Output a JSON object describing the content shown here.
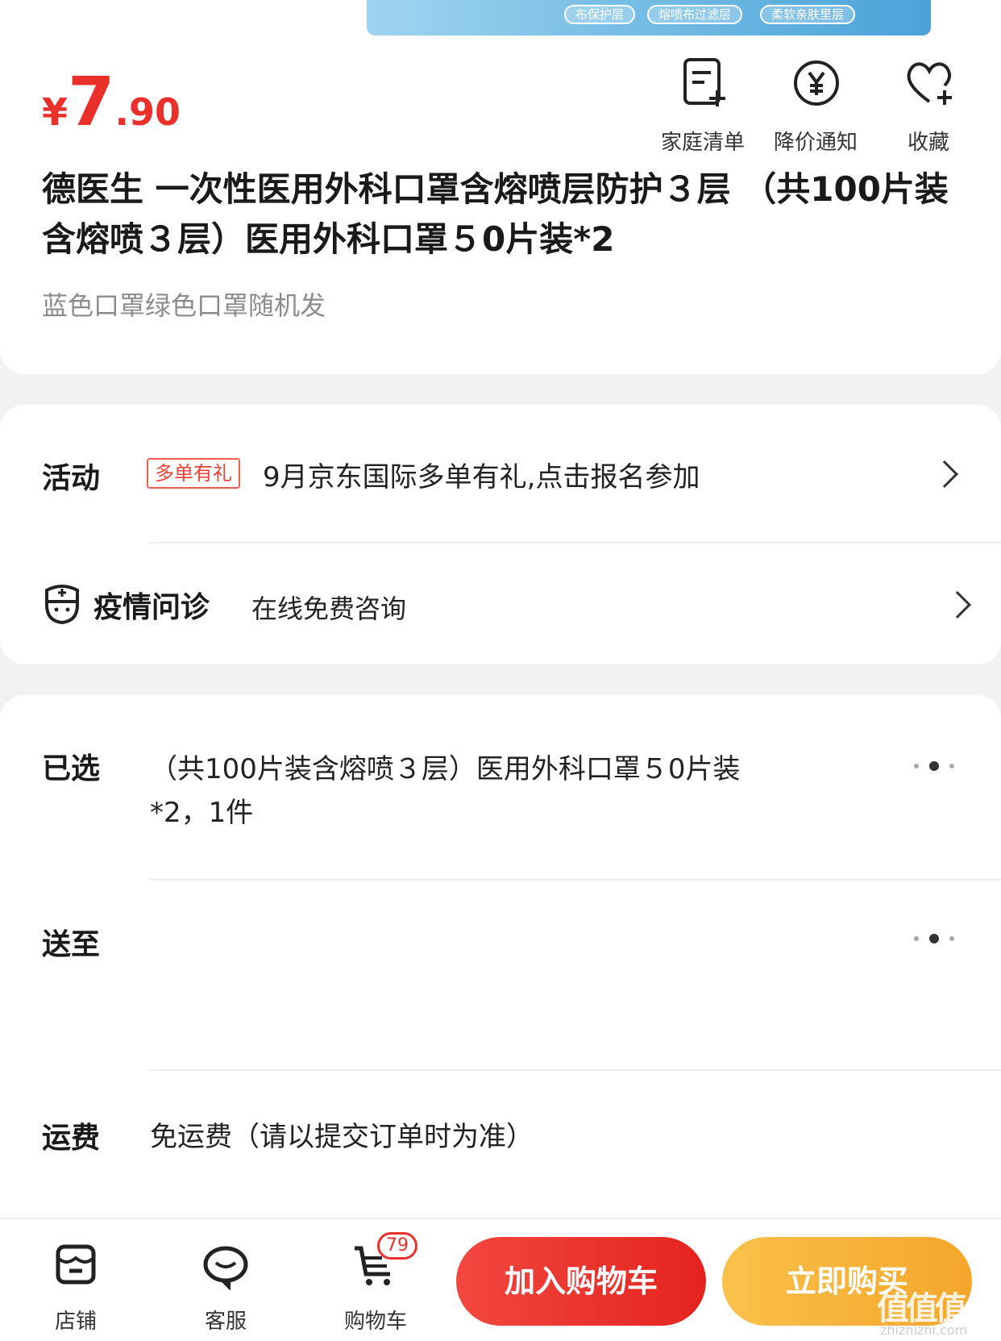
{
  "hero": {
    "tags": [
      "布保护层",
      "熔喷布过滤层",
      "柔软亲肤里层"
    ]
  },
  "price": {
    "currency": "¥",
    "integer": "7",
    "decimal": ".90"
  },
  "actions": [
    {
      "label": "家庭清单",
      "icon": "list-add-icon"
    },
    {
      "label": "降价通知",
      "icon": "price-alert-icon"
    },
    {
      "label": "收藏",
      "icon": "heart-add-icon"
    }
  ],
  "product": {
    "title": "德医生 一次性医用外科口罩含熔喷层防护３层 （共100片装含熔喷３层）医用外科口罩５0片装*2",
    "subtitle": "蓝色口罩绿色口罩随机发"
  },
  "activity": {
    "label": "活动",
    "badge": "多单有礼",
    "text": "9月京东国际多单有礼,点击报名参加"
  },
  "consult": {
    "label": "疫情问诊",
    "text": "在线免费咨询"
  },
  "selection": {
    "selected_label": "已选",
    "selected_line1": "（共100片装含熔喷３层）医用外科口罩５0片装",
    "selected_line2": "*2，1件",
    "ship_to_label": "送至",
    "freight_label": "运费",
    "freight_text": "免运费（请以提交订单时为准）"
  },
  "bottom_nav": {
    "shop": "店铺",
    "service": "客服",
    "cart": "购物车",
    "cart_count": "79",
    "add_to_cart": "加入购物车",
    "buy_now": "立即购买"
  },
  "watermark": {
    "text": "值值值",
    "sub": "zhizhizhi.com"
  },
  "colors": {
    "accent": "#e9302b",
    "buy": "#f4a62a"
  }
}
